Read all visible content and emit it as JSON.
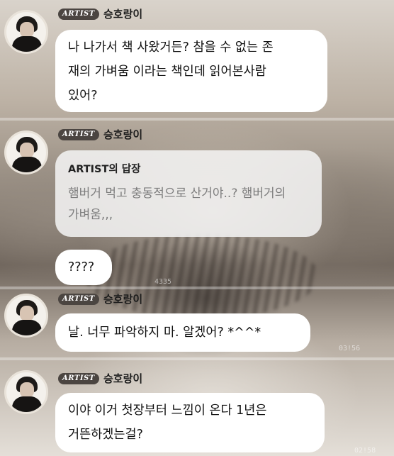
{
  "artist_badge": "ARTIST",
  "sender_name": "승호랑이",
  "messages": [
    {
      "type": "text",
      "text_lines": [
        "나 나가서 책 사왔거든? 참을 수 없는 존",
        "재의 가벼움 이라는 책인데 읽어본사람",
        "있어?"
      ]
    },
    {
      "type": "reply",
      "reply_title": "ARTIST의 답장",
      "quoted_lines": [
        "햄버거 먹고 충동적으로 산거야..? 햄버거의",
        "가벼움,,,"
      ],
      "reply_text": "????"
    },
    {
      "type": "text",
      "text_lines": [
        "날. 너무 파악하지 마. 알겠어? *^^*"
      ]
    },
    {
      "type": "text",
      "text_lines": [
        "이야 이거 첫장부터 느낌이 온다 1년은",
        "거뜬하겠는걸?"
      ]
    }
  ],
  "watermarks": [
    "4335",
    "03!56",
    "02!58"
  ]
}
